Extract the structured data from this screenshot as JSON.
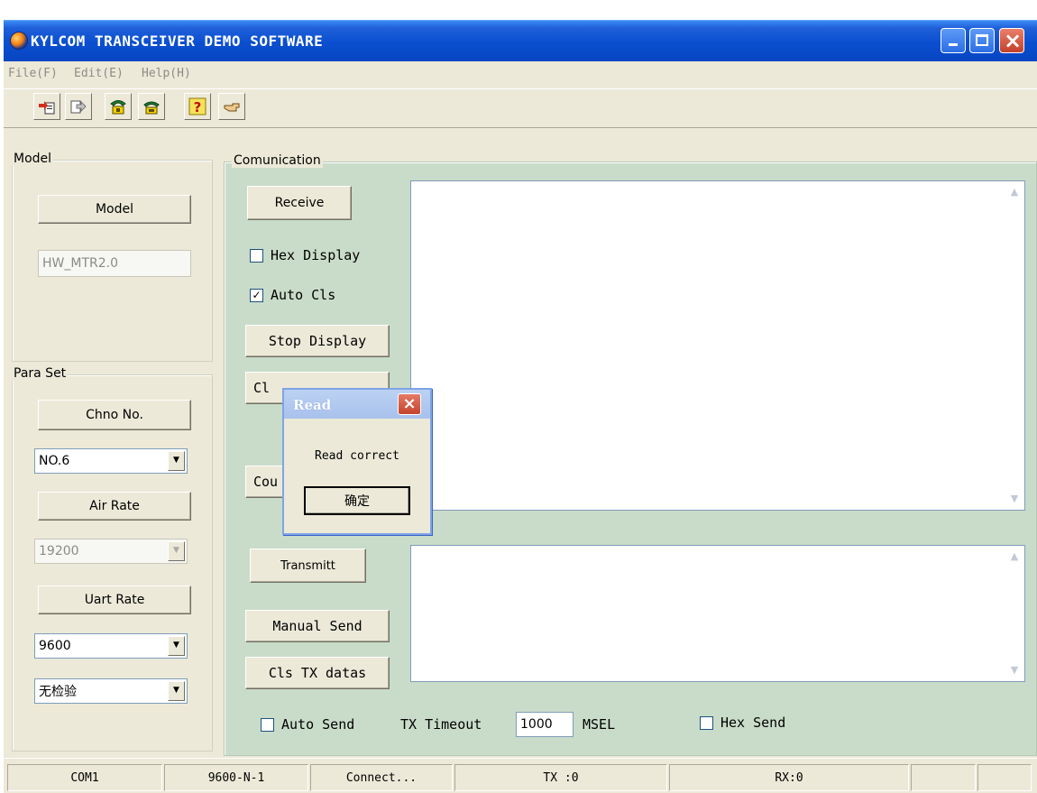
{
  "window": {
    "title": "KYLCOM TRANSCEIVER DEMO SOFTWARE"
  },
  "menu": [
    {
      "label": "File(F)"
    },
    {
      "label": "Edit(E)"
    },
    {
      "label": "Help(H)"
    }
  ],
  "toolbar": {
    "icons": [
      "import-icon",
      "export-icon",
      "phone-connect-icon",
      "phone-disconnect-icon",
      "help-icon",
      "pointer-icon"
    ]
  },
  "model_group": {
    "title": "Model",
    "button_label": "Model",
    "value": "HW_MTR2.0"
  },
  "para_group": {
    "title": "Para Set",
    "chno_label": "Chno No.",
    "chno_value": "NO.6",
    "air_rate_label": "Air Rate",
    "air_rate_value": "19200",
    "uart_rate_label": "Uart Rate",
    "uart_rate_value": "9600",
    "parity_value": "无检验"
  },
  "comm_group": {
    "title": "Comunication",
    "receive_label": "Receive",
    "hex_display_label": "Hex Display",
    "hex_display_checked": false,
    "auto_cls_label": "Auto Cls",
    "auto_cls_checked": true,
    "stop_display_label": "Stop Display",
    "cls_partial_label": "Cl",
    "count_partial_label": "Cou",
    "transmitt_label": "Transmitt",
    "manual_send_label": "Manual Send",
    "cls_tx_label": "Cls TX datas",
    "auto_send_label": "Auto Send",
    "tx_timeout_label": "TX Timeout",
    "tx_timeout_value": "1000",
    "msel_label": "MSEL",
    "hex_send_label": "Hex Send"
  },
  "status": {
    "port": "COM1",
    "settings": "9600-N-1",
    "connection": "Connect...",
    "tx": "TX :0",
    "rx": "RX:0"
  },
  "dialog": {
    "title": "Read",
    "message": "Read correct",
    "ok_label": "确定"
  }
}
